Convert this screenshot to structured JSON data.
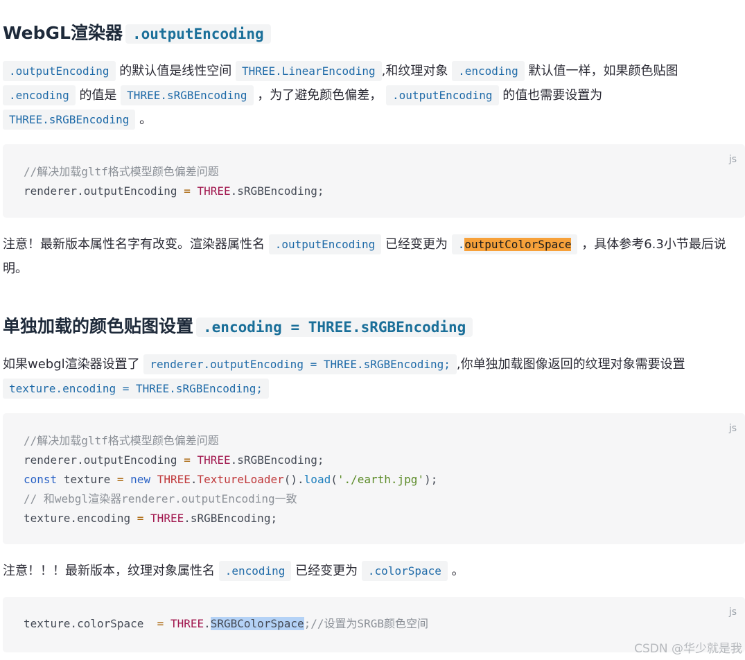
{
  "section1": {
    "heading_text": "WebGL渲染器",
    "heading_code": ".outputEncoding",
    "para1": {
      "c1": ".outputEncoding",
      "t1": "的默认值是线性空间",
      "c2": "THREE.LinearEncoding",
      "t2": ",和纹理对象",
      "c3": ".encoding",
      "t3": "默认值一样，如果颜色贴图",
      "c4": ".encoding",
      "t4": "的值是",
      "c5": "THREE.sRGBEncoding",
      "t5": "，为了避免颜色偏差，",
      "c6": ".outputEncoding",
      "t6": "的值也需要设置为",
      "c7": "THREE.sRGBEncoding",
      "t7": "。"
    },
    "code1": {
      "lang": "js",
      "comment": "//解决加载gltf格式模型颜色偏差问题",
      "l2_a": "renderer",
      "l2_b": ".outputEncoding",
      "l2_eq": "=",
      "l2_c": "THREE",
      "l2_d": ".sRGBEncoding;"
    },
    "note": {
      "t1": "注意！最新版本属性名字有改变。渲染器属性名",
      "c1": ".outputEncoding",
      "t2": "已经变更为",
      "c2a": ".",
      "c2b": "outputColorSpace",
      "t3": "，具体参考6.3小节最后说明。"
    }
  },
  "section2": {
    "heading_text": "单独加载的颜色贴图设置",
    "heading_code": ".encoding = THREE.sRGBEncoding",
    "para": {
      "t1": "如果webgl渲染器设置了",
      "c1": "renderer.outputEncoding = THREE.sRGBEncoding;",
      "t2": ",你单独加载图像返回的纹理对象需要设置",
      "c2": "texture.encoding = THREE.sRGBEncoding;"
    },
    "code2": {
      "lang": "js",
      "l1": "//解决加载gltf格式模型颜色偏差问题",
      "l2_a": "renderer.outputEncoding",
      "l2_eq": "=",
      "l2_c": "THREE",
      "l2_d": ".sRGBEncoding;",
      "l3_const": "const",
      "l3_var": "texture",
      "l3_eq": "=",
      "l3_new": "new",
      "l3_three": "THREE",
      "l3_dot": ".",
      "l3_loader": "TextureLoader",
      "l3_call": "().",
      "l3_load": "load",
      "l3_open": "(",
      "l3_str": "'./earth.jpg'",
      "l3_close": ");",
      "l4": "// 和webgl渲染器renderer.outputEncoding一致",
      "l5_a": "texture.encoding",
      "l5_eq": "=",
      "l5_c": "THREE",
      "l5_d": ".sRGBEncoding;"
    },
    "note": {
      "t1": "注意！！！最新版本，纹理对象属性名",
      "c1": ".encoding",
      "t2": "已经变更为",
      "c2": ".colorSpace",
      "t3": "。"
    },
    "code3": {
      "lang": "js",
      "a": "texture.colorSpace",
      "eq": "=",
      "c": "THREE",
      "dot": ".",
      "sel": "SRGBColorSpace",
      "comment": ";//设置为SRGB颜色空间"
    }
  },
  "watermark": "CSDN @华少就是我"
}
